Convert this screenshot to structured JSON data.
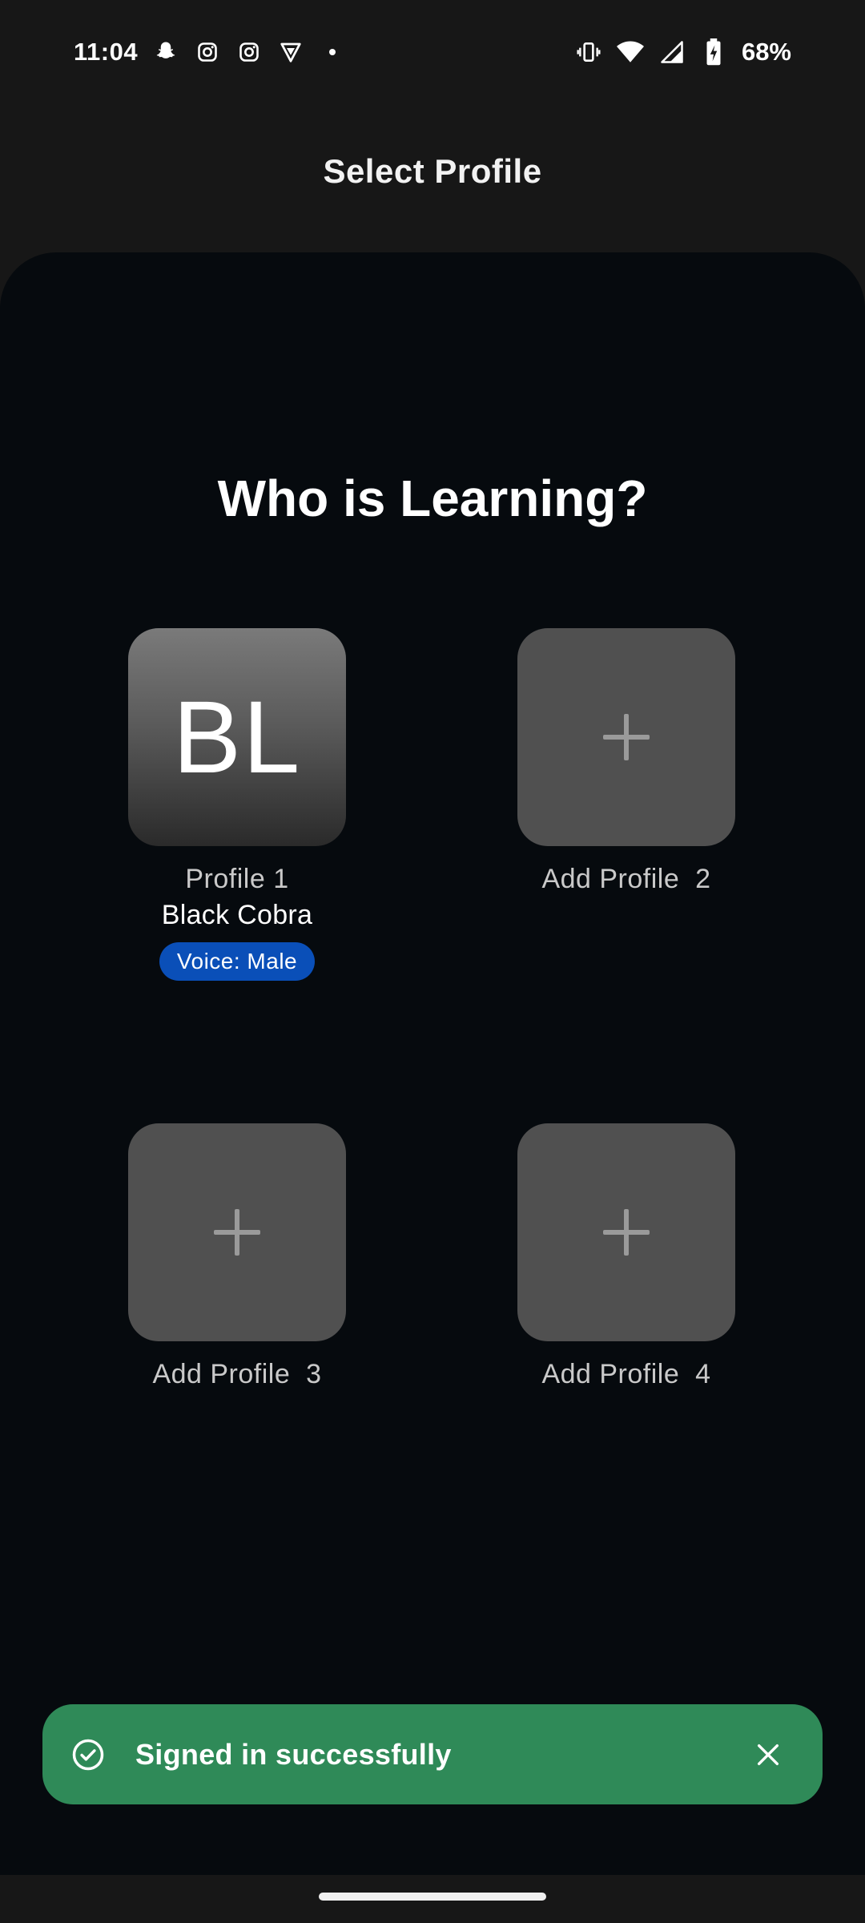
{
  "status_bar": {
    "time": "11:04",
    "battery": "68%",
    "left_icons": [
      "snapchat-icon",
      "instagram-icon",
      "instagram-icon",
      "vpn-icon",
      "dot-icon"
    ],
    "right_icons": [
      "vibrate-icon",
      "wifi-icon",
      "signal-icon",
      "battery-charging-icon"
    ]
  },
  "app_bar": {
    "title": "Select Profile"
  },
  "main": {
    "heading": "Who is Learning?",
    "profiles": [
      {
        "initials": "BL",
        "label": "Profile 1",
        "name": "Black Cobra",
        "voice": "Voice: Male"
      },
      {
        "label": "Add Profile  2",
        "icon": "plus-icon"
      },
      {
        "label": "Add Profile  3",
        "icon": "plus-icon"
      },
      {
        "label": "Add Profile  4",
        "icon": "plus-icon"
      }
    ]
  },
  "snackbar": {
    "message": "Signed in successfully",
    "icon": "check-circle-icon",
    "close_icon": "close-icon"
  },
  "colors": {
    "background": "#171717",
    "sheet": "#060a0e",
    "tile_add": "#505050",
    "voice_badge": "#0a4fb8",
    "snackbar": "#2f8a58"
  }
}
